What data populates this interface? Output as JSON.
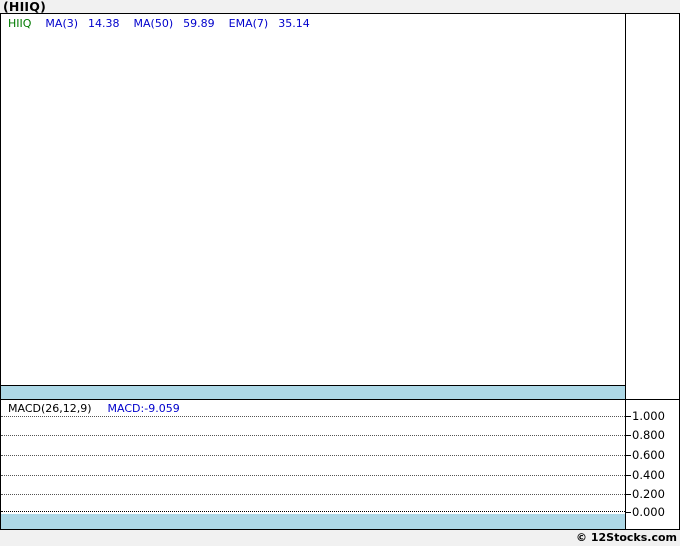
{
  "page": {
    "title": "(HIIQ)",
    "footer_credit": "© 12Stocks.com"
  },
  "price_panel": {
    "legend": {
      "symbol": "HIIQ",
      "items": [
        {
          "label": "MA(3)",
          "value": "14.38"
        },
        {
          "label": "MA(50)",
          "value": "59.89"
        },
        {
          "label": "EMA(7)",
          "value": "35.14"
        }
      ]
    }
  },
  "macd_panel": {
    "label": "MACD(26,12,9)",
    "value_label": "MACD:-9.059",
    "axis_ticks": [
      "1.000",
      "0.800",
      "0.600",
      "0.400",
      "0.200",
      "0.000"
    ]
  },
  "colors": {
    "symbol_green": "#007a00",
    "indicator_blue": "#0000cc",
    "band_blue": "#add8e6",
    "page_background": "#f1f1f1",
    "panel_background": "#ffffff",
    "border_black": "#000000"
  },
  "chart_data": {
    "type": "line",
    "title": "(HIIQ)",
    "legend_position": "top-left inside each panel",
    "grid": "dotted horizontal lines in MACD panel only",
    "panels": [
      {
        "name": "price",
        "series": [
          {
            "name": "HIIQ",
            "color": "green"
          },
          {
            "name": "MA(3)",
            "last_value": 14.38
          },
          {
            "name": "MA(50)",
            "last_value": 59.89
          },
          {
            "name": "EMA(7)",
            "last_value": 35.14
          }
        ],
        "visible_data_points": [],
        "note": "price panel renders blank/white in the screenshot"
      },
      {
        "name": "macd",
        "indicator": "MACD(26,12,9)",
        "current_value": -9.059,
        "ylim": [
          0.0,
          1.0
        ],
        "yticks": [
          1.0,
          0.8,
          0.6,
          0.4,
          0.2,
          0.0
        ],
        "visible_data_points": [],
        "note": "MACD value -9.059 is below the displayed 0.000-1.000 range, so no line is visible"
      }
    ]
  }
}
